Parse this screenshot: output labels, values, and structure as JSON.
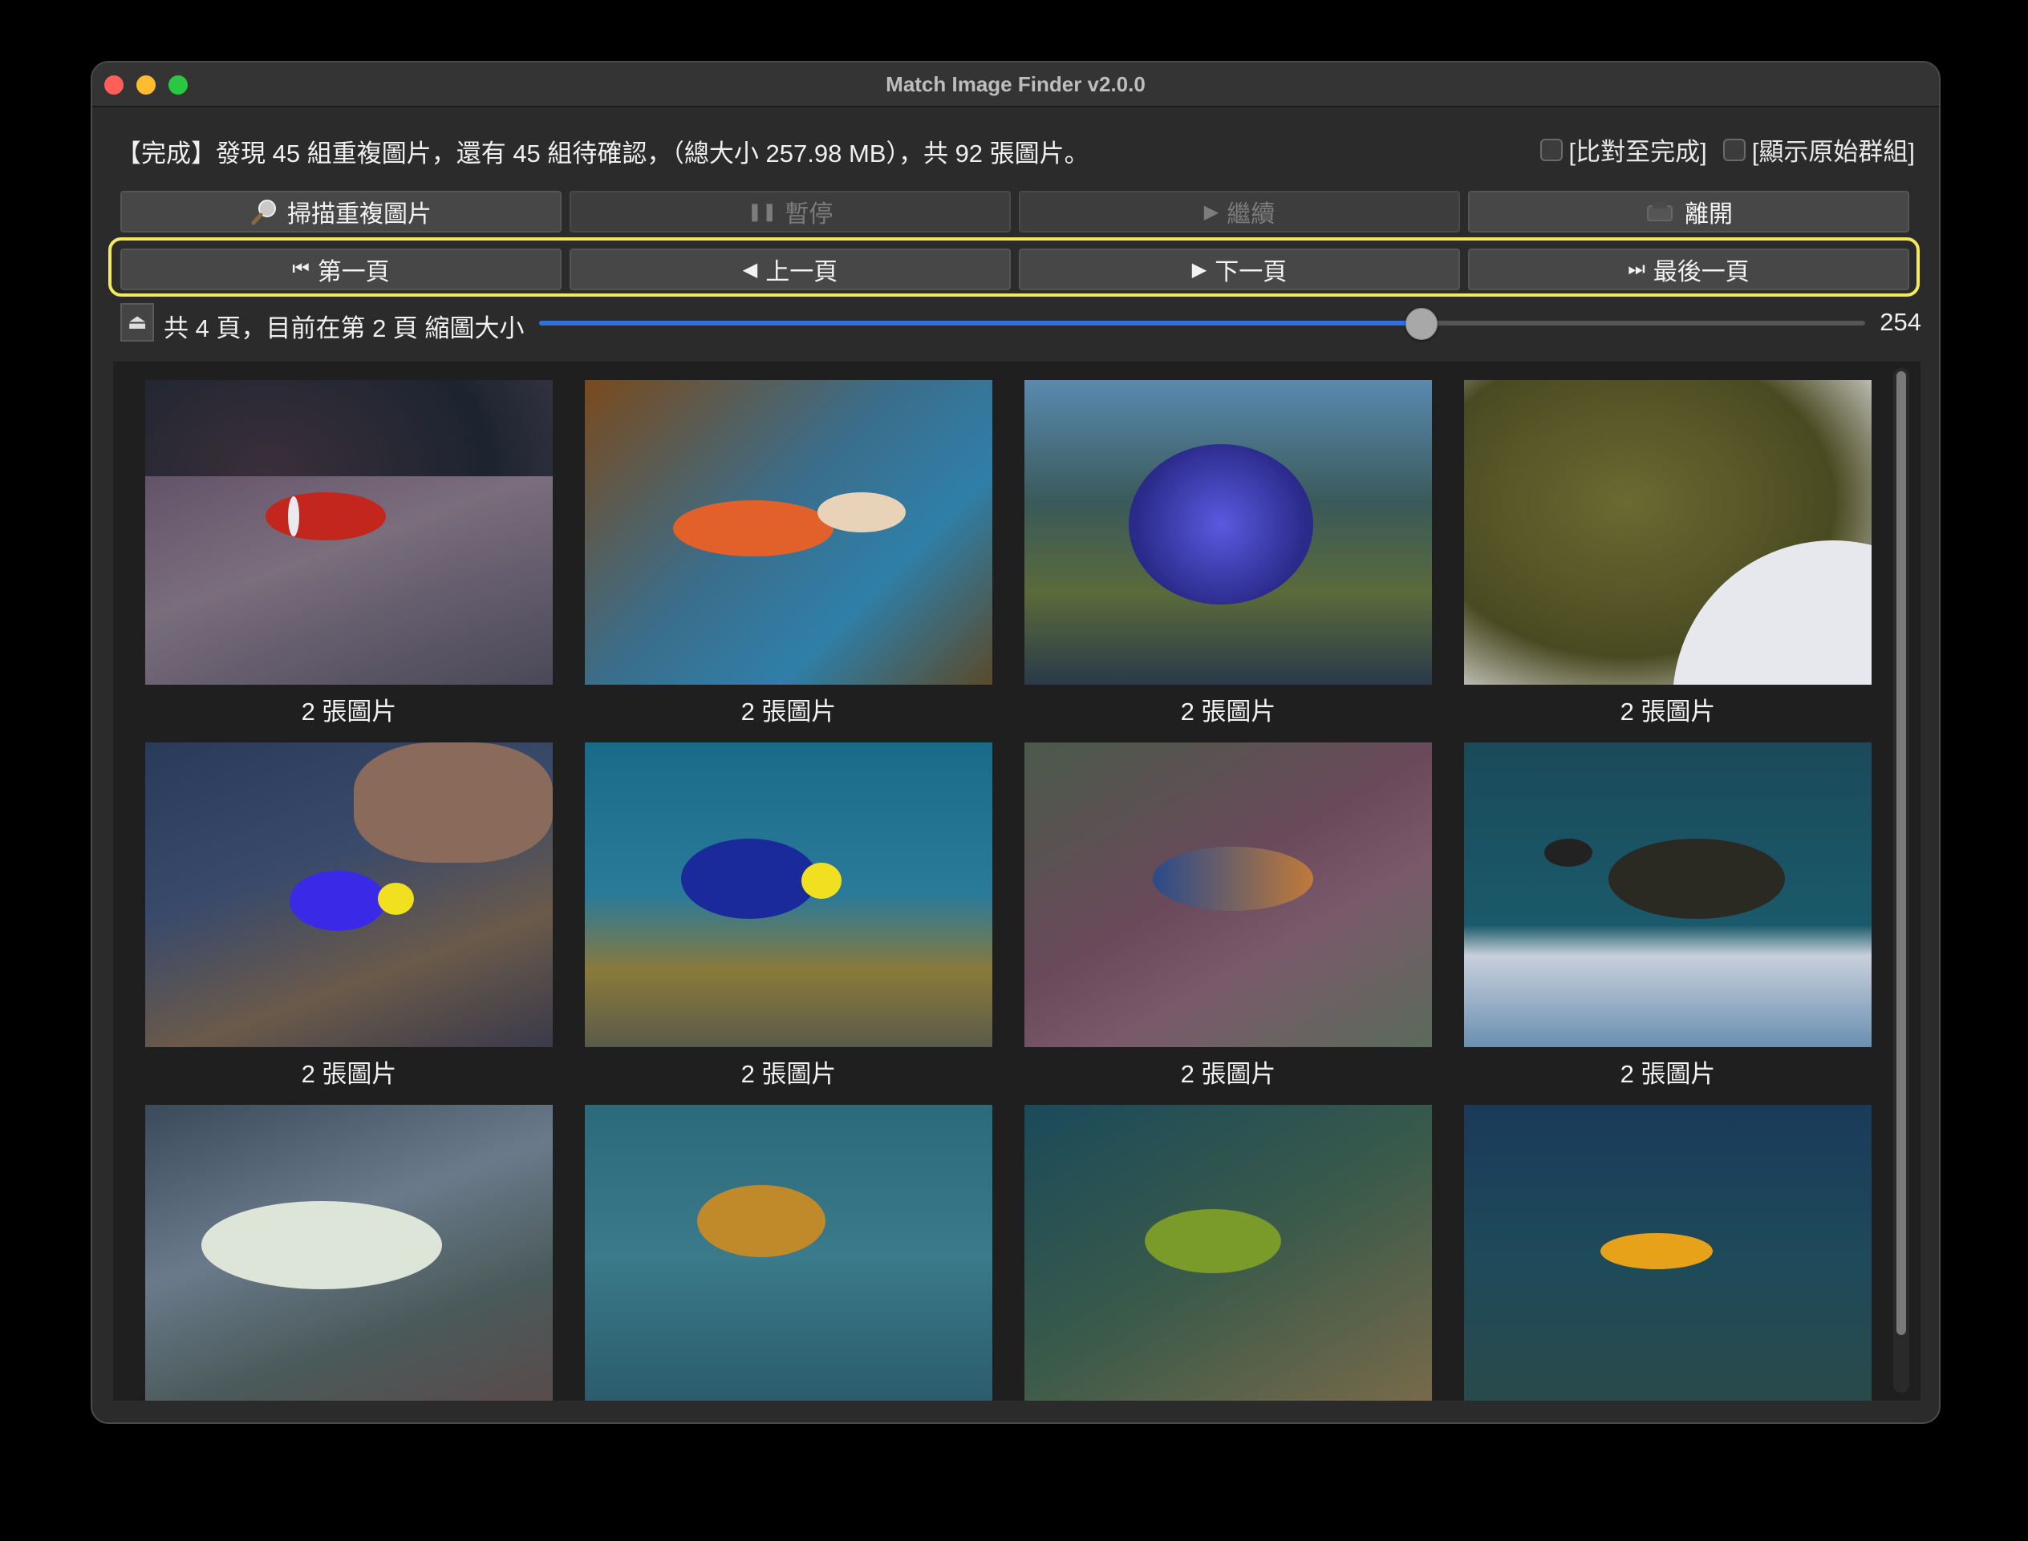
{
  "window": {
    "title": "Match Image Finder v2.0.0"
  },
  "status": {
    "text": "【完成】發現 45 組重複圖片，還有 45 組待確認，（總大小 257.98 MB），共 92 張圖片。"
  },
  "options": [
    {
      "label": "[比對至完成]",
      "checked": false
    },
    {
      "label": "[顯示原始群組]",
      "checked": false
    }
  ],
  "toolbar": {
    "scan_label": "掃描重複圖片",
    "pause_label": "暫停",
    "resume_label": "繼續",
    "exit_label": "離開"
  },
  "pagination": {
    "first_label": "第一頁",
    "prev_label": "上一頁",
    "next_label": "下一頁",
    "last_label": "最後一頁",
    "info": "共 4 頁，目前在第 2 頁 縮圖大小",
    "thumb_size": "254"
  },
  "slider": {
    "fraction": 0.665
  },
  "gallery": {
    "captions": [
      "2 張圖片",
      "2 張圖片",
      "2 張圖片",
      "2 張圖片",
      "2 張圖片",
      "2 張圖片",
      "2 張圖片",
      "2 張圖片"
    ]
  },
  "icons": [
    "magnifier-icon",
    "pause-icon",
    "play-icon",
    "exit-icon",
    "first-page-icon",
    "prev-page-icon",
    "next-page-icon",
    "last-page-icon",
    "collapse-icon"
  ],
  "colors": {
    "accent": "#2f6fe0",
    "highlight": "#f2ea5a"
  }
}
